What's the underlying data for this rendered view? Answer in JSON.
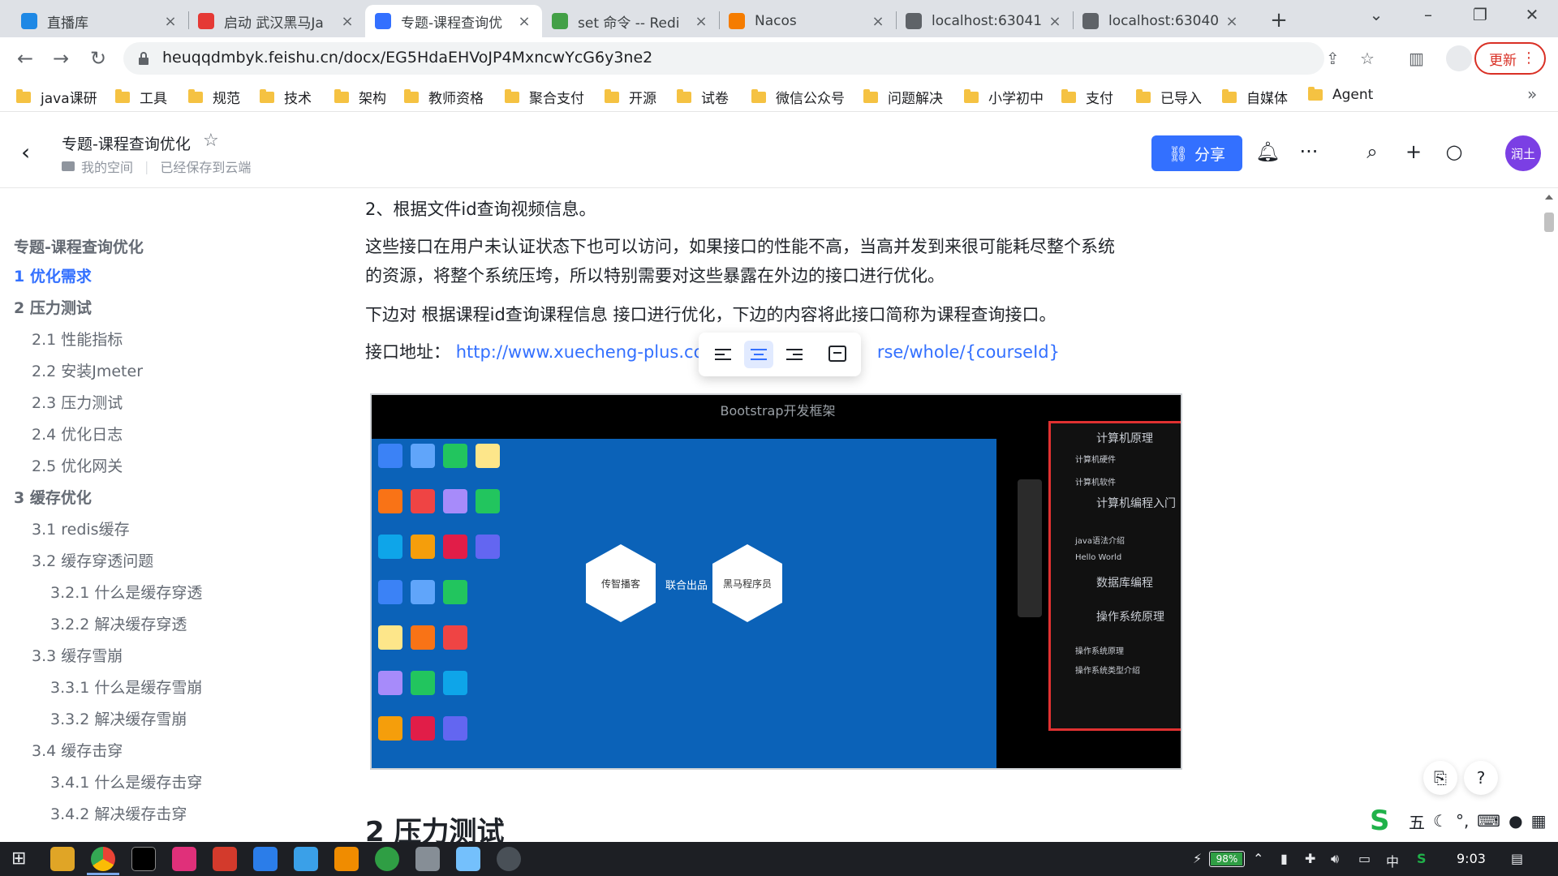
{
  "browser": {
    "tabs": [
      {
        "label": "直播库",
        "icon": "bilibili-icon",
        "color": "#1e88e5"
      },
      {
        "label": "启动 武汉黑马Ja",
        "icon": "video-icon",
        "color": "#e53935"
      },
      {
        "label": "专题-课程查询优",
        "icon": "feishu-doc-icon",
        "color": "#3370ff",
        "active": true
      },
      {
        "label": "set 命令 -- Redi",
        "icon": "redis-icon",
        "color": "#43a047"
      },
      {
        "label": "Nacos",
        "icon": "nacos-icon",
        "color": "#f57c00"
      },
      {
        "label": "localhost:63041",
        "icon": "globe-icon",
        "color": "#5f6368"
      },
      {
        "label": "localhost:63040",
        "icon": "globe-icon",
        "color": "#5f6368"
      }
    ],
    "url": "heuqqdmbyk.feishu.cn/docx/EG5HdaEHVoJP4MxncwYcG6y3ne2",
    "update_label": "更新",
    "bookmarks": [
      "java课研",
      "工具",
      "规范",
      "技术",
      "架构",
      "教师资格",
      "聚合支付",
      "开源",
      "试卷",
      "微信公众号",
      "问题解决",
      "小学初中",
      "支付",
      "已导入",
      "自媒体",
      "Agent"
    ]
  },
  "doc_header": {
    "title": "专题-课程查询优化",
    "space": "我的空间",
    "save_status": "已经保存到云端",
    "share_label": "分享",
    "avatar_text": "润土"
  },
  "toc": [
    {
      "label": "专题-课程查询优化",
      "level": 0
    },
    {
      "label": "1 优化需求",
      "level": 1,
      "active": true
    },
    {
      "label": "2 压力测试",
      "level": 1
    },
    {
      "label": "2.1 性能指标",
      "level": 2
    },
    {
      "label": "2.2 安装Jmeter",
      "level": 2
    },
    {
      "label": "2.3 压力测试",
      "level": 2
    },
    {
      "label": "2.4 优化日志",
      "level": 2
    },
    {
      "label": "2.5 优化网关",
      "level": 2
    },
    {
      "label": "3 缓存优化",
      "level": 1
    },
    {
      "label": "3.1 redis缓存",
      "level": 2
    },
    {
      "label": "3.2 缓存穿透问题",
      "level": 2
    },
    {
      "label": "3.2.1 什么是缓存穿透",
      "level": 3
    },
    {
      "label": "3.2.2 解决缓存穿透",
      "level": 3
    },
    {
      "label": "3.3 缓存雪崩",
      "level": 2
    },
    {
      "label": "3.3.1 什么是缓存雪崩",
      "level": 3
    },
    {
      "label": "3.3.2 解决缓存雪崩",
      "level": 3
    },
    {
      "label": "3.4 缓存击穿",
      "level": 2
    },
    {
      "label": "3.4.1 什么是缓存击穿",
      "level": 3
    },
    {
      "label": "3.4.2 解决缓存击穿",
      "level": 3
    }
  ],
  "content": {
    "p1": "2、根据文件id查询视频信息。",
    "p2_line1": "这些接口在用户未认证状态下也可以访问，如果接口的性能不高，当高并发到来很可能耗尽整个系统",
    "p2_line2": "的资源，将整个系统压垮，所以特别需要对这些暴露在外边的接口进行优化。",
    "p3": "下边对 根据课程id查询课程信息 接口进行优化，下边的内容将此接口简称为课程查询接口。",
    "p4_label": "接口地址：",
    "p4_link_start": "http://www.xuecheng-plus.co",
    "p4_link_end": "rse/whole/{courseId}",
    "image": {
      "title": "Bootstrap开发框架",
      "joint_label": "联合出品",
      "logo_left": "传智播客",
      "logo_right": "黑马程序员",
      "panel_items": [
        {
          "text": "计算机原理",
          "type": "header"
        },
        {
          "text": "计算机硬件",
          "type": "item"
        },
        {
          "text": "计算机软件",
          "type": "item"
        },
        {
          "text": "计算机编程入门",
          "type": "header"
        },
        {
          "text": "java语法介绍",
          "type": "item"
        },
        {
          "text": "Hello World",
          "type": "item"
        },
        {
          "text": "数据库编程",
          "type": "header"
        },
        {
          "text": "操作系统原理",
          "type": "header"
        },
        {
          "text": "操作系统原理",
          "type": "item"
        },
        {
          "text": "操作系统类型介绍",
          "type": "item"
        }
      ]
    },
    "section_heading": "2 压力测试"
  },
  "ime": {
    "mode": "五"
  },
  "taskbar": {
    "battery": "98%",
    "battery_level": 0.98,
    "lang": "中",
    "time": "9:03"
  }
}
